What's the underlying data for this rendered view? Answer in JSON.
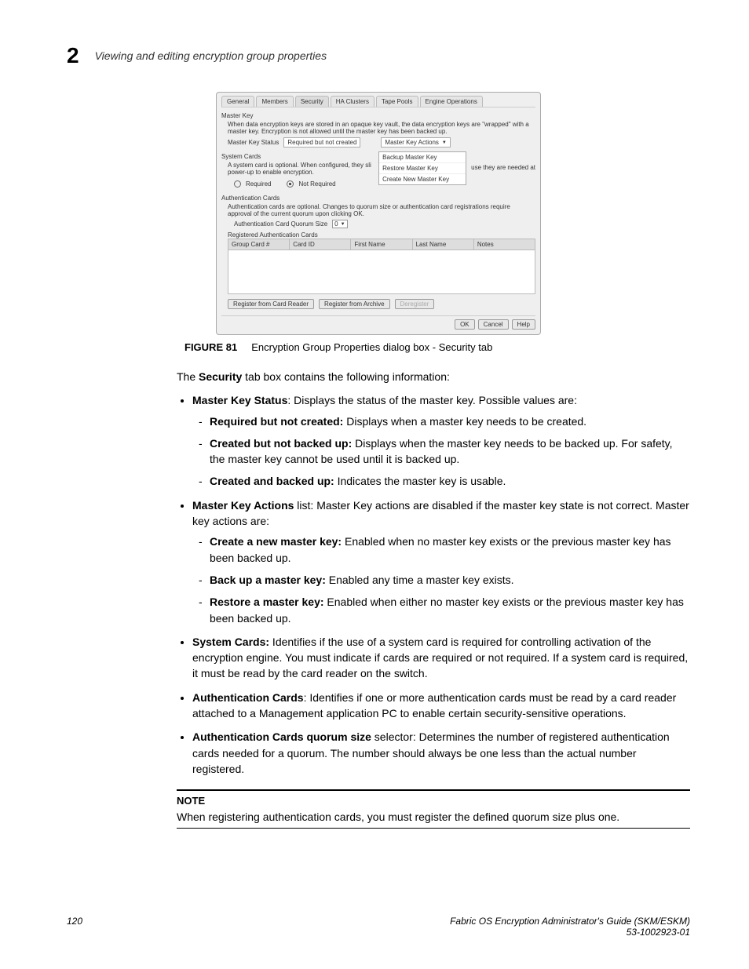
{
  "header": {
    "chapter_number": "2",
    "title": "Viewing and editing encryption group properties"
  },
  "dialog": {
    "tabs": [
      "General",
      "Members",
      "Security",
      "HA Clusters",
      "Tape Pools",
      "Engine Operations"
    ],
    "active_tab": "Security",
    "master_key": {
      "title": "Master Key",
      "desc": "When data encryption keys are stored in an opaque key vault, the data encryption keys are \"wrapped\" with a master key. Encryption is not allowed until the master key has been backed up.",
      "status_label": "Master Key Status",
      "status_value": "Required but not created",
      "actions_label": "Master Key Actions",
      "actions": [
        "Backup Master Key",
        "Restore Master Key",
        "Create New Master Key"
      ]
    },
    "system_cards": {
      "title": "System Cards",
      "desc_left": "A system card is optional. When configured, they sli",
      "desc_line2": "power-up to enable encryption.",
      "desc_right": "use they are needed at",
      "req_label": "Required",
      "not_req_label": "Not Required"
    },
    "auth_cards": {
      "title": "Authentication Cards",
      "desc": "Authentication cards are optional. Changes to quorum size or authentication card registrations require approval of the current quorum upon clicking OK.",
      "quorum_label": "Authentication Card Quorum Size",
      "quorum_value": "0",
      "reg_label": "Registered Authentication Cards",
      "columns": [
        "Group Card #",
        "Card ID",
        "First Name",
        "Last Name",
        "Notes"
      ],
      "btn_reader": "Register from Card Reader",
      "btn_archive": "Register from Archive",
      "btn_dereg": "Deregister"
    },
    "footer_buttons": {
      "ok": "OK",
      "cancel": "Cancel",
      "help": "Help"
    }
  },
  "figure": {
    "label": "FIGURE 81",
    "caption": "Encryption Group Properties dialog box - Security tab"
  },
  "intro": {
    "prefix": "The ",
    "bold": "Security",
    "suffix": " tab box contains the following information:"
  },
  "bullets": {
    "b1": {
      "bold": "Master Key Status",
      "rest": ": Displays the status of the master key. Possible values are:"
    },
    "b1a": {
      "bold": "Required but not created:",
      "rest": " Displays when a master key needs to be created."
    },
    "b1b": {
      "bold": "Created but not backed up:",
      "rest": " Displays when the master key needs to be backed up. For safety, the master key cannot be used until it is backed up."
    },
    "b1c": {
      "bold": "Created and backed up:",
      "rest": " Indicates the master key is usable."
    },
    "b2": {
      "bold": "Master Key Actions",
      "rest": " list: Master Key actions are disabled if the master key state is not correct. Master key actions are:"
    },
    "b2a": {
      "bold": "Create a new master key:",
      "rest": " Enabled when no master key exists or the previous master key has been backed up."
    },
    "b2b": {
      "bold": "Back up a master key:",
      "rest": " Enabled any time a master key exists."
    },
    "b2c": {
      "bold": "Restore a master key:",
      "rest": " Enabled when either no master key exists or the previous master key has been backed up."
    },
    "b3": {
      "bold": "System Cards:",
      "rest": " Identifies if the use of a system card is required for controlling activation of the encryption engine. You must indicate if cards are required or not required. If a system card is required, it must be read by the card reader on the switch."
    },
    "b4": {
      "bold": "Authentication Cards",
      "rest": ": Identifies if one or more authentication cards must be read by a card reader attached to a Management application PC to enable certain security-sensitive operations."
    },
    "b5": {
      "bold": "Authentication Cards quorum size",
      "rest": " selector: Determines the number of registered authentication cards needed for a quorum. The number should always be one less than the actual number registered."
    }
  },
  "note": {
    "label": "NOTE",
    "text": "When registering authentication cards, you must register the defined quorum size plus one."
  },
  "page_footer": {
    "page_num": "120",
    "doc_title": "Fabric OS Encryption Administrator's Guide (SKM/ESKM)",
    "doc_id": "53-1002923-01"
  }
}
